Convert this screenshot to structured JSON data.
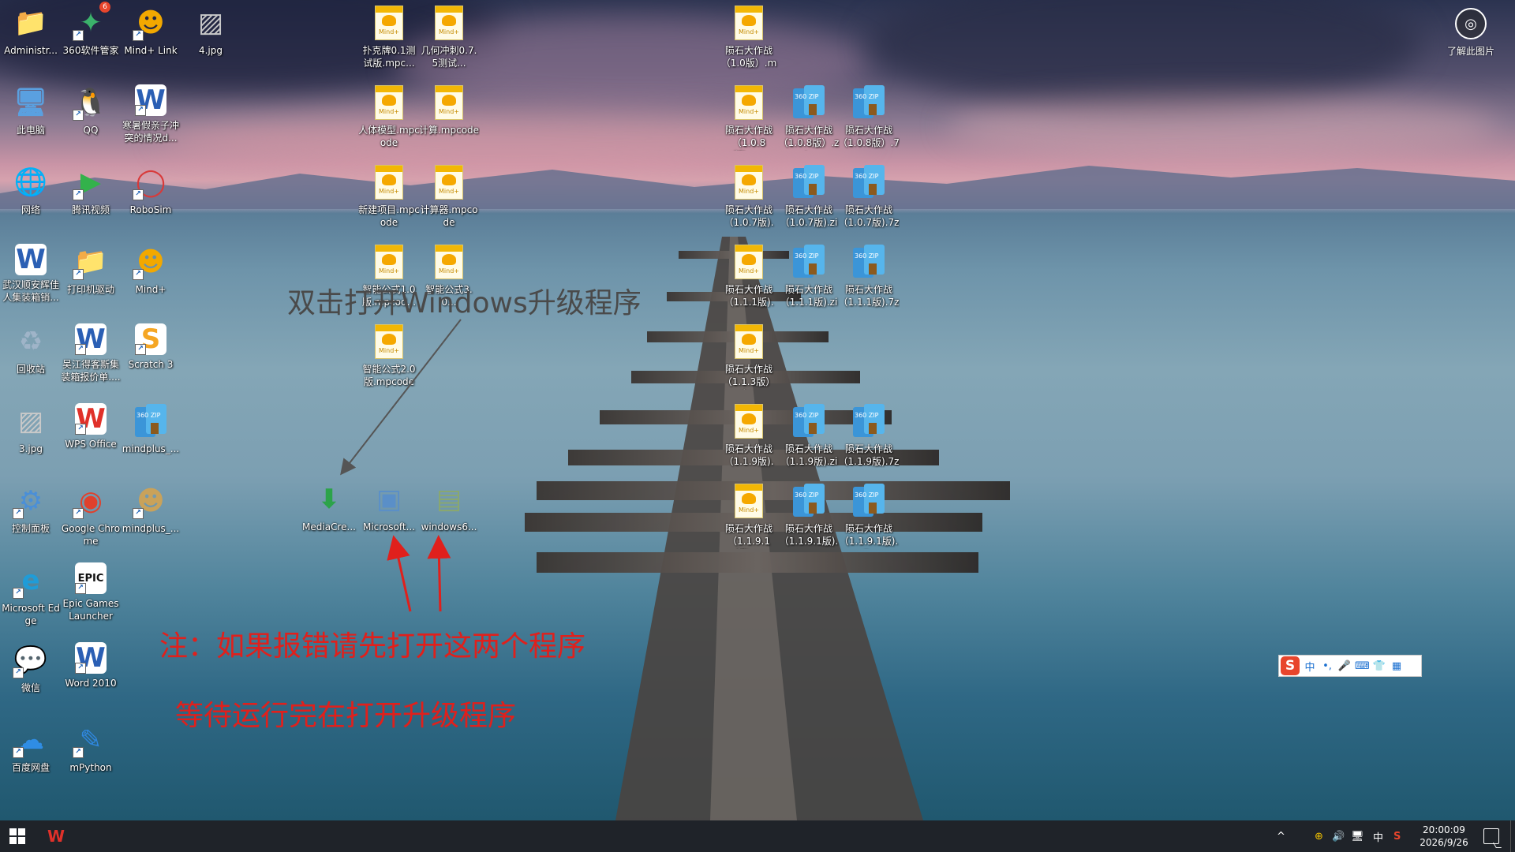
{
  "desktop": {
    "icons_col1": [
      {
        "label": "Administr...",
        "icon": "user-folder-icon"
      },
      {
        "label": "此电脑",
        "icon": "computer-icon"
      },
      {
        "label": "网络",
        "icon": "network-icon"
      },
      {
        "label": "武汉顺安辉佳人集装箱销...",
        "icon": "word-doc-icon"
      },
      {
        "label": "回收站",
        "icon": "recycle-bin-icon"
      },
      {
        "label": "3.jpg",
        "icon": "image-file-icon"
      },
      {
        "label": "控制面板",
        "icon": "control-panel-icon"
      },
      {
        "label": "Microsoft Edge",
        "icon": "edge-icon"
      },
      {
        "label": "微信",
        "icon": "wechat-icon"
      },
      {
        "label": "百度网盘",
        "icon": "baidu-netdisk-icon"
      }
    ],
    "icons_col2": [
      {
        "label": "360软件管家",
        "icon": "360-software-icon",
        "badge": "6"
      },
      {
        "label": "QQ",
        "icon": "qq-icon"
      },
      {
        "label": "腾讯视频",
        "icon": "tencent-video-icon"
      },
      {
        "label": "打印机驱动",
        "icon": "folder-icon"
      },
      {
        "label": "吴江得客斯集装箱报价单....",
        "icon": "word-doc-icon"
      },
      {
        "label": "WPS Office",
        "icon": "wps-icon"
      },
      {
        "label": "Google Chrome",
        "icon": "chrome-icon"
      },
      {
        "label": "Epic Games Launcher",
        "icon": "epic-games-icon"
      },
      {
        "label": "Word 2010",
        "icon": "word-icon"
      },
      {
        "label": "mPython",
        "icon": "mpython-icon"
      }
    ],
    "icons_col3": [
      {
        "label": "Mind+ Link",
        "icon": "mindplus-link-icon"
      },
      {
        "label": "寒暑假亲子冲突的情况d...",
        "icon": "word-doc-icon"
      },
      {
        "label": "RoboSim",
        "icon": "robosim-icon"
      },
      {
        "label": "Mind+",
        "icon": "mindplus-icon"
      },
      {
        "label": "Scratch 3",
        "icon": "scratch-icon"
      },
      {
        "label": "mindplus_...",
        "icon": "zip-icon"
      },
      {
        "label": "mindplus_...",
        "icon": "mindplus-installer-icon"
      }
    ],
    "icon_col4": [
      {
        "label": "4.jpg",
        "icon": "image-file-icon"
      }
    ],
    "mpcode_col_a": [
      {
        "label": "扑克牌0.1测试版.mpc..."
      },
      {
        "label": "人体模型.mpcode"
      },
      {
        "label": "新建项目.mpcode"
      },
      {
        "label": "智能公式1.0版.mpcod..."
      },
      {
        "label": "智能公式2.0版.mpcode"
      }
    ],
    "mpcode_col_b": [
      {
        "label": "几何冲刺0.7.5测试..."
      },
      {
        "label": "计算.mpcode"
      },
      {
        "label": "计算器.mpcode"
      },
      {
        "label": "智能公式3.0..."
      }
    ],
    "setup_icons": [
      {
        "label": "MediaCre...",
        "icon": "media-creation-tool-icon"
      },
      {
        "label": "Microsoft...",
        "icon": "microsoft-installer-icon"
      },
      {
        "label": "windows6...",
        "icon": "windows-update-icon"
      }
    ],
    "meteor_rows": [
      {
        "mpcode": "陨石大作战（1.0版）.mp...",
        "zip": "",
        "sevenz": ""
      },
      {
        "mpcode": "陨石大作战（1.0.8版）....",
        "zip": "陨石大作战（1.0.8版）.zip",
        "sevenz": "陨石大作战（1.0.8版）.7z"
      },
      {
        "mpcode": "陨石大作战（1.0.7版).m...",
        "zip": "陨石大作战（1.0.7版).zip",
        "sevenz": "陨石大作战（1.0.7版).7z"
      },
      {
        "mpcode": "陨石大作战（1.1.1版).m...",
        "zip": "陨石大作战（1.1.1版).zip",
        "sevenz": "陨石大作战（1.1.1版).7z"
      },
      {
        "mpcode": "陨石大作战（1.1.3版）内...",
        "zip": "",
        "sevenz": ""
      },
      {
        "mpcode": "陨石大作战（1.1.9版).m...",
        "zip": "陨石大作战（1.1.9版).zip",
        "sevenz": "陨石大作战（1.1.9版).7z"
      },
      {
        "mpcode": "陨石大作战（1.1.9.1版)....",
        "zip": "陨石大作战（1.1.9.1版).z...",
        "sevenz": "陨石大作战（1.1.9.1版).7z"
      }
    ],
    "file_type_tags": {
      "mpcode": "Mind+",
      "zip": "360 ZIP"
    }
  },
  "annotations": {
    "instruction_top": "双击打开Windows升级程序",
    "note_error": "注：如果报错请先打开这两个程序",
    "note_wait": "等待运行完在打开升级程序",
    "arrow_color": "#e0201c",
    "text_color_gray": "#4a4a4a"
  },
  "learn_picture": {
    "label": "了解此图片"
  },
  "ime": {
    "logo": "S",
    "items": [
      "中",
      "•,",
      "🎤",
      "⌨",
      "👕",
      "▦"
    ]
  },
  "taskbar": {
    "tray": [
      "^",
      "⊕",
      "🔊",
      "🖥",
      "中",
      "S"
    ],
    "time": "20:00:09",
    "date": "2026/9/26"
  }
}
